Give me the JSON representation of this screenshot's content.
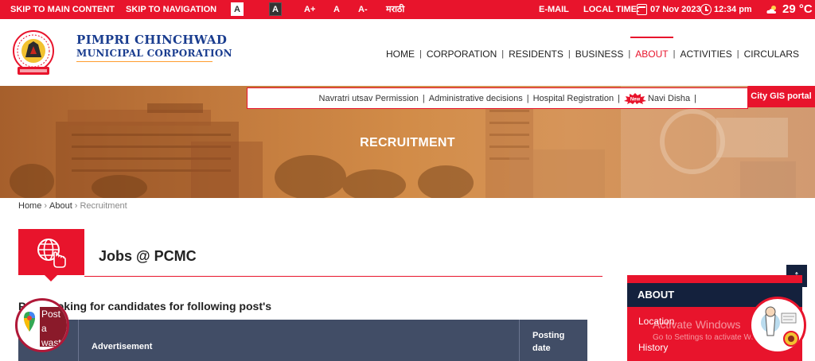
{
  "topbar": {
    "skip_main": "SKIP TO MAIN CONTENT",
    "skip_nav": "SKIP TO NAVIGATION",
    "contrast_light": "A",
    "contrast_dark": "A",
    "font_plus": "A+",
    "font_normal": "A",
    "font_minus": "A-",
    "language": "मराठी",
    "email": "E-MAIL",
    "local_time_label": "LOCAL TIME:",
    "date": "07 Nov 2023",
    "time": "12:34 pm",
    "temperature": "29 °C",
    "background_color": "#e8142c"
  },
  "header": {
    "brand_line1": "PIMPRI CHINCHWAD",
    "brand_line2": "MUNICIPAL CORPORATION",
    "nav": [
      {
        "label": "HOME"
      },
      {
        "label": "CORPORATION"
      },
      {
        "label": "RESIDENTS"
      },
      {
        "label": "BUSINESS"
      },
      {
        "label": "ABOUT",
        "active": true
      },
      {
        "label": "ACTIVITIES"
      },
      {
        "label": "CIRCULARS"
      }
    ]
  },
  "hero": {
    "title": "RECRUITMENT"
  },
  "quicklinks": {
    "items": [
      "Navratri utsav Permission",
      "Administrative decisions",
      "Hospital Registration"
    ],
    "new_badge": "New",
    "new_item": "Navi Disha",
    "gis_button": "City GIS portal"
  },
  "breadcrumb": {
    "home": "Home",
    "about": "About",
    "current": "Recruitment"
  },
  "main": {
    "section_icon": "web-click-icon",
    "section_title": "Jobs @ PCMC",
    "intro": "P       looking for candidates for following post's",
    "table_headers": {
      "advertisement": "Advertisement",
      "posting_date": "Posting date"
    }
  },
  "sidebar": {
    "scroll_top": "↑",
    "heading": "ABOUT",
    "links": [
      "Location",
      "History"
    ]
  },
  "overlay": {
    "watermark_line1": "Activate Windows",
    "watermark_line2": "Go to Settings to activate Windows.",
    "post_waste": "Post a\nwaste"
  },
  "colors": {
    "accent": "#e8142c",
    "navy": "#14213d",
    "brand_blue": "#1a3d8f",
    "table_header": "#414d66"
  }
}
